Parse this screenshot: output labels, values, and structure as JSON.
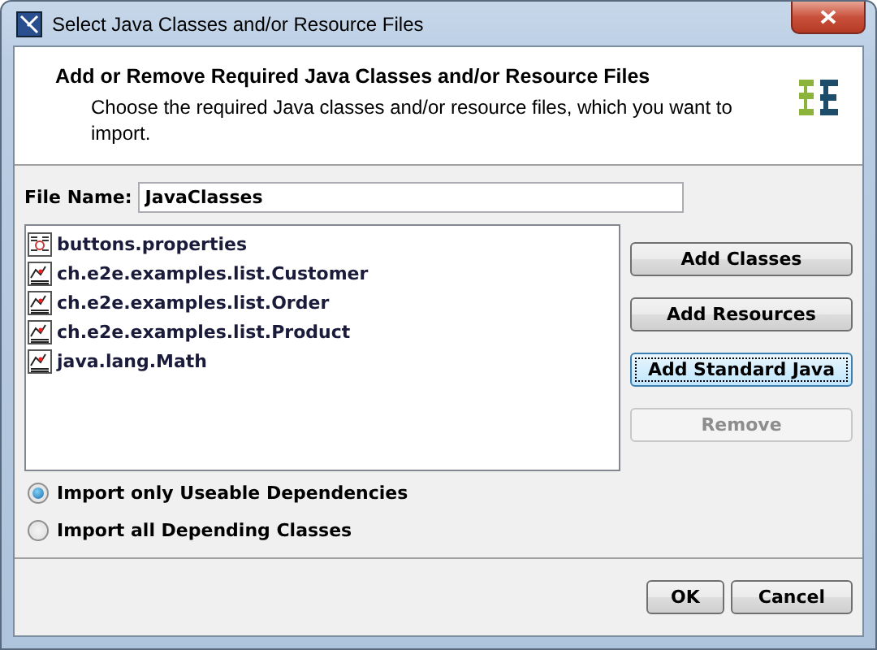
{
  "window": {
    "title": "Select Java Classes and/or Resource Files"
  },
  "header": {
    "title": "Add or Remove Required Java Classes and/or Resource Files",
    "description": "Choose the required Java classes and/or resource files, which you want to import."
  },
  "file_name": {
    "label": "File Name:",
    "value": "JavaClasses"
  },
  "items": [
    {
      "label": "buttons.properties",
      "kind": "resource"
    },
    {
      "label": "ch.e2e.examples.list.Customer",
      "kind": "class"
    },
    {
      "label": "ch.e2e.examples.list.Order",
      "kind": "class"
    },
    {
      "label": "ch.e2e.examples.list.Product",
      "kind": "class"
    },
    {
      "label": "java.lang.Math",
      "kind": "class"
    }
  ],
  "side_buttons": [
    {
      "label": "Add Classes",
      "focused": false,
      "disabled": false
    },
    {
      "label": "Add Resources",
      "focused": false,
      "disabled": false
    },
    {
      "label": "Add Standard Java",
      "focused": true,
      "disabled": false
    },
    {
      "label": "Remove",
      "focused": false,
      "disabled": true
    }
  ],
  "options": [
    {
      "label": "Import only Useable Dependencies",
      "selected": true
    },
    {
      "label": "Import all Depending Classes",
      "selected": false
    }
  ],
  "buttons": [
    "OK",
    "Cancel"
  ]
}
